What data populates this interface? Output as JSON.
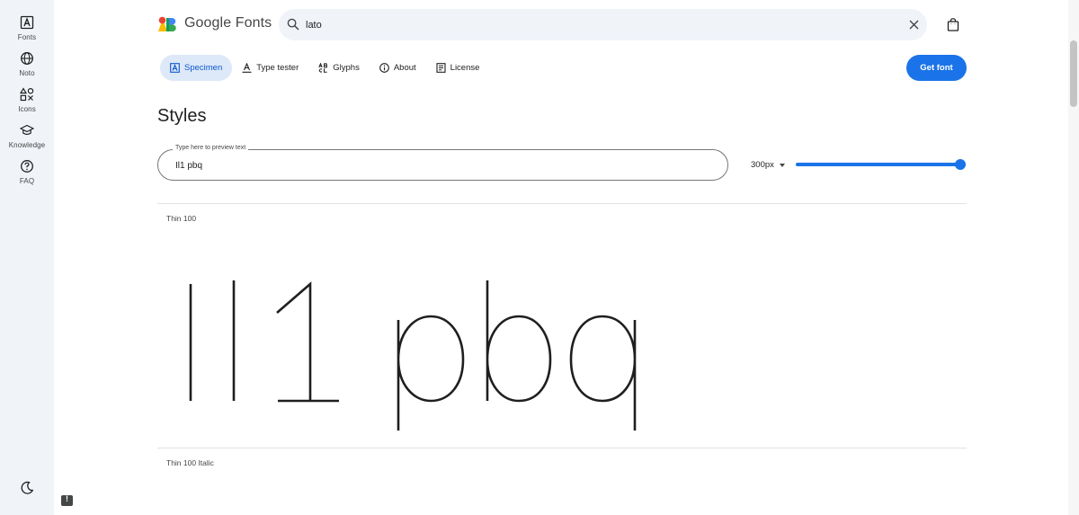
{
  "rail": {
    "items": [
      {
        "label": "Fonts",
        "icon": "fonts-icon"
      },
      {
        "label": "Noto",
        "icon": "globe-icon"
      },
      {
        "label": "Icons",
        "icon": "shapes-icon"
      },
      {
        "label": "Knowledge",
        "icon": "school-icon"
      },
      {
        "label": "FAQ",
        "icon": "help-icon"
      }
    ],
    "theme_icon": "dark-mode-icon"
  },
  "header": {
    "logo_text": "Google Fonts",
    "search_value": "lato",
    "bag_icon": "shopping-bag-icon"
  },
  "tabs": [
    {
      "label": "Specimen",
      "icon": "specimen-icon",
      "active": true
    },
    {
      "label": "Type tester",
      "icon": "type-tester-icon",
      "active": false
    },
    {
      "label": "Glyphs",
      "icon": "glyphs-icon",
      "active": false
    },
    {
      "label": "About",
      "icon": "info-icon",
      "active": false
    },
    {
      "label": "License",
      "icon": "license-icon",
      "active": false
    }
  ],
  "get_font_label": "Get font",
  "styles": {
    "title": "Styles",
    "preview_label": "Type here to preview text",
    "preview_value": "Il1 pbq",
    "size_label": "300px",
    "slider_fraction": 1.0,
    "list": [
      {
        "name": "Thin 100"
      },
      {
        "name": "Thin 100 Italic"
      }
    ]
  },
  "colors": {
    "accent": "#1a73e8",
    "rail_bg": "#f0f4f9",
    "active_tab_bg": "#dde8f8"
  }
}
